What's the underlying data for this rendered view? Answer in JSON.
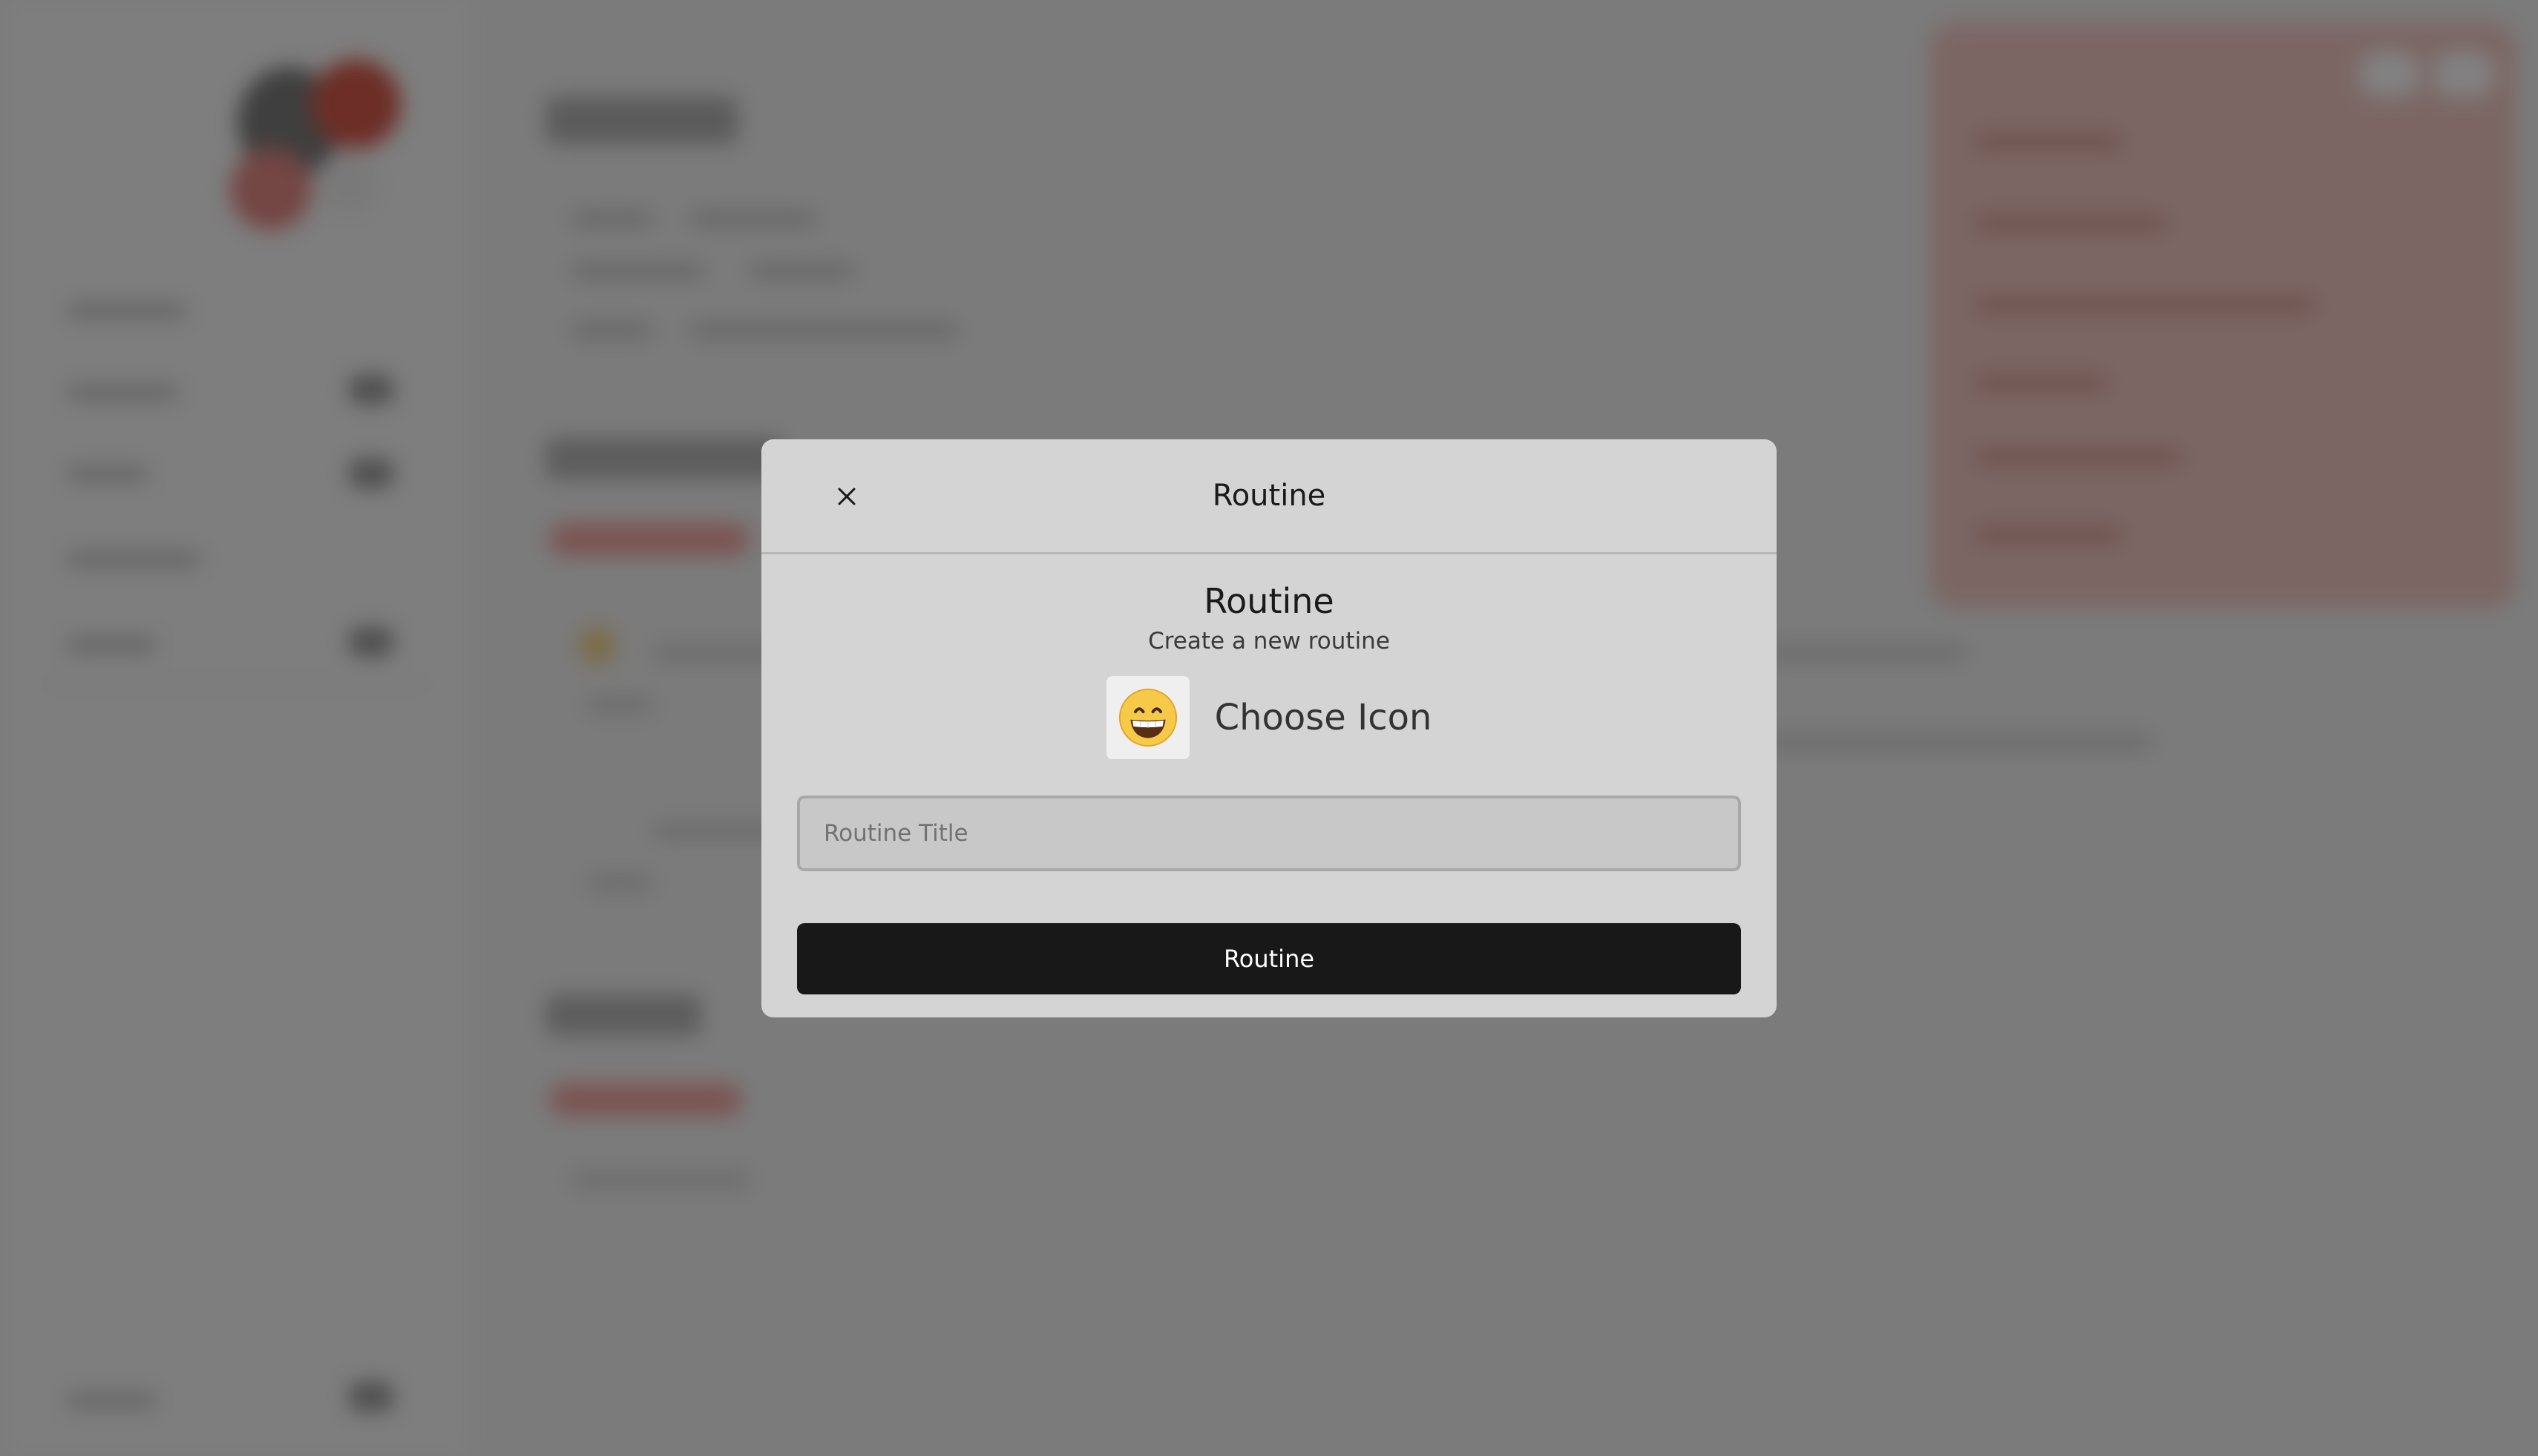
{
  "modal": {
    "header_title": "Routine",
    "body_title": "Routine",
    "subtitle": "Create a new routine",
    "choose_icon_label": "Choose Icon",
    "title_placeholder": "Routine Title",
    "title_value": "",
    "submit_label": "Routine"
  },
  "icons": {
    "close": "close-icon",
    "selected_emoji": "grinning-face-with-smiling-eyes"
  },
  "colors": {
    "overlay": "#000000",
    "modal_bg": "#d4d4d4",
    "submit_bg": "#181818",
    "submit_text": "#ffffff"
  }
}
